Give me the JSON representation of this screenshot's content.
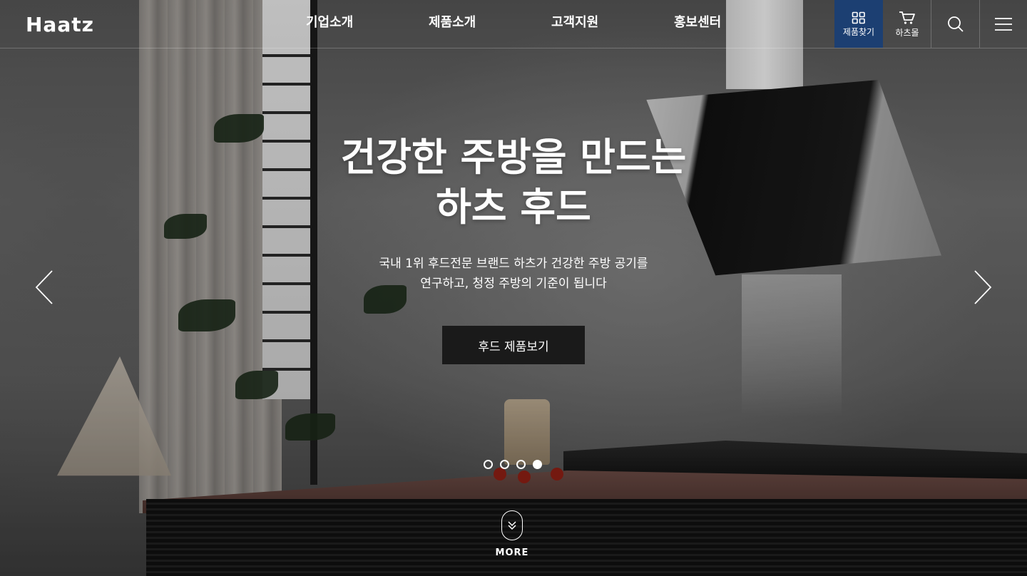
{
  "header": {
    "logo_text": "Haatz",
    "nav": [
      {
        "label": "기업소개"
      },
      {
        "label": "제품소개"
      },
      {
        "label": "고객지원"
      },
      {
        "label": "홍보센터"
      }
    ],
    "utilities": {
      "product_finder": {
        "label": "제품찾기",
        "icon": "grid-icon"
      },
      "mall": {
        "label": "하츠몰",
        "icon": "cart-icon"
      },
      "search": {
        "icon": "search-icon"
      },
      "menu": {
        "icon": "menu-icon"
      }
    }
  },
  "hero": {
    "headline_line1": "건강한 주방을 만드는",
    "headline_line2": "하츠 후드",
    "sub_line1": "국내 1위 후드전문 브랜드 하츠가 건강한 주방 공기를",
    "sub_line2": "연구하고, 청정 주방의 기준이 됩니다",
    "cta_label": "후드 제품보기",
    "slider": {
      "total": 4,
      "active_index": 4
    },
    "more_label": "MORE"
  },
  "colors": {
    "active_util_bg": "#1c3f72",
    "cta_bg": "#1a1a1a"
  }
}
